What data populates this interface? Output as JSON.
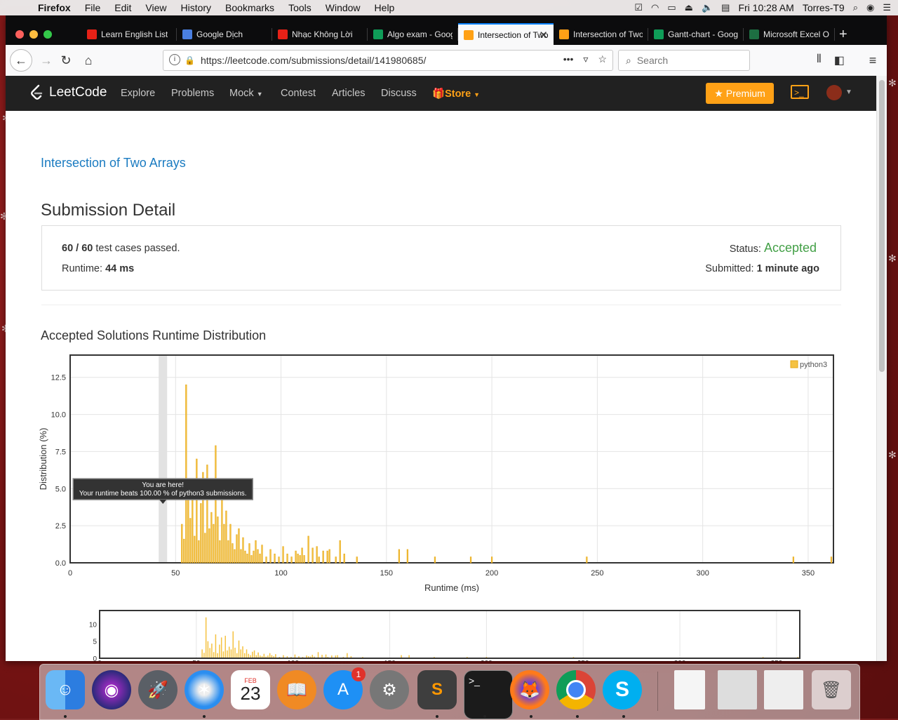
{
  "menubar": {
    "app": "Firefox",
    "items": [
      "File",
      "Edit",
      "View",
      "History",
      "Bookmarks",
      "Tools",
      "Window",
      "Help"
    ],
    "clock": "Fri 10:28 AM",
    "user": "Torres-T9"
  },
  "browser": {
    "tabs": [
      {
        "label": "Learn English List",
        "fav_color": "#e62117",
        "fav_icon": "play-icon"
      },
      {
        "label": "Google Dịch",
        "fav_color": "#4a7fe0",
        "fav_icon": "translate-icon"
      },
      {
        "label": "Nhạc Không Lời",
        "fav_color": "#e62117",
        "fav_icon": "play-icon"
      },
      {
        "label": "Algo exam - Google",
        "fav_color": "#0f9d58",
        "fav_icon": "sheet-icon"
      },
      {
        "label": "Intersection of Two",
        "fav_color": "#ffa116",
        "fav_icon": "leetcode-icon",
        "active": true
      },
      {
        "label": "Intersection of Two",
        "fav_color": "#ffa116",
        "fav_icon": "leetcode-icon"
      },
      {
        "label": "Gantt-chart - Google",
        "fav_color": "#0f9d58",
        "fav_icon": "sheet-icon"
      },
      {
        "label": "Microsoft Excel Onl",
        "fav_color": "#1d6f42",
        "fav_icon": "excel-icon"
      }
    ],
    "url": "https://leetcode.com/submissions/detail/141980685/",
    "search_placeholder": "Search"
  },
  "leetcode": {
    "logo": "LeetCode",
    "nav": [
      "Explore",
      "Problems",
      "Mock",
      "Contest",
      "Articles",
      "Discuss"
    ],
    "store": "Store",
    "premium": "Premium",
    "problem": "Intersection of Two Arrays",
    "title": "Submission Detail",
    "cases_passed": "60 / 60",
    "cases_suffix": "test cases passed.",
    "runtime_label": "Runtime:",
    "runtime_value": "44 ms",
    "status_label": "Status:",
    "status_value": "Accepted",
    "submitted_label": "Submitted:",
    "submitted_value": "1 minute ago",
    "chart_heading": "Accepted Solutions Runtime Distribution"
  },
  "chart_data": {
    "type": "bar",
    "xlabel": "Runtime (ms)",
    "ylabel": "Distribution (%)",
    "xlim": [
      0,
      362
    ],
    "ylim": [
      0,
      14
    ],
    "xticks": [
      0,
      50,
      100,
      150,
      200,
      250,
      300,
      350
    ],
    "yticks": [
      0.0,
      2.5,
      5.0,
      7.5,
      10.0,
      12.5
    ],
    "legend": "top-right",
    "series": [
      {
        "name": "python3",
        "color": "#f5c242"
      }
    ],
    "highlight_x": 44,
    "tooltip_title": "You are here!",
    "tooltip_text": "Your runtime beats 100.00 % of python3 submissions.",
    "points": [
      [
        53,
        2.6
      ],
      [
        54,
        1.6
      ],
      [
        55,
        12.0
      ],
      [
        56,
        5.0
      ],
      [
        57,
        3.0
      ],
      [
        58,
        4.3
      ],
      [
        59,
        1.8
      ],
      [
        60,
        7.0
      ],
      [
        61,
        1.5
      ],
      [
        62,
        4.0
      ],
      [
        63,
        6.1
      ],
      [
        64,
        2.0
      ],
      [
        65,
        6.6
      ],
      [
        66,
        2.3
      ],
      [
        67,
        3.4
      ],
      [
        68,
        2.6
      ],
      [
        69,
        7.9
      ],
      [
        70,
        3.1
      ],
      [
        71,
        1.5
      ],
      [
        72,
        5.2
      ],
      [
        73,
        2.6
      ],
      [
        74,
        3.5
      ],
      [
        75,
        1.5
      ],
      [
        76,
        2.6
      ],
      [
        77,
        1.3
      ],
      [
        78,
        0.9
      ],
      [
        79,
        1.9
      ],
      [
        80,
        2.3
      ],
      [
        81,
        0.9
      ],
      [
        82,
        1.7
      ],
      [
        83,
        0.8
      ],
      [
        84,
        0.6
      ],
      [
        85,
        1.3
      ],
      [
        86,
        0.5
      ],
      [
        87,
        0.8
      ],
      [
        88,
        1.5
      ],
      [
        89,
        0.9
      ],
      [
        90,
        0.6
      ],
      [
        91,
        1.2
      ],
      [
        93,
        0.4
      ],
      [
        95,
        0.9
      ],
      [
        97,
        0.6
      ],
      [
        99,
        0.4
      ],
      [
        101,
        1.1
      ],
      [
        103,
        0.6
      ],
      [
        105,
        0.4
      ],
      [
        107,
        0.8
      ],
      [
        108,
        0.6
      ],
      [
        109,
        0.5
      ],
      [
        110,
        1.0
      ],
      [
        111,
        0.5
      ],
      [
        113,
        1.8
      ],
      [
        115,
        1.0
      ],
      [
        117,
        1.1
      ],
      [
        118,
        0.4
      ],
      [
        120,
        0.8
      ],
      [
        122,
        0.8
      ],
      [
        123,
        0.9
      ],
      [
        126,
        0.4
      ],
      [
        128,
        1.5
      ],
      [
        130,
        0.6
      ],
      [
        136,
        0.4
      ],
      [
        156,
        0.9
      ],
      [
        160,
        0.9
      ],
      [
        173,
        0.4
      ],
      [
        190,
        0.4
      ],
      [
        200,
        0.4
      ],
      [
        245,
        0.4
      ],
      [
        343,
        0.4
      ],
      [
        361,
        0.4
      ]
    ]
  },
  "dock": {
    "calendar_month": "FEB",
    "calendar_day": "23",
    "appstore_badge": "1"
  }
}
